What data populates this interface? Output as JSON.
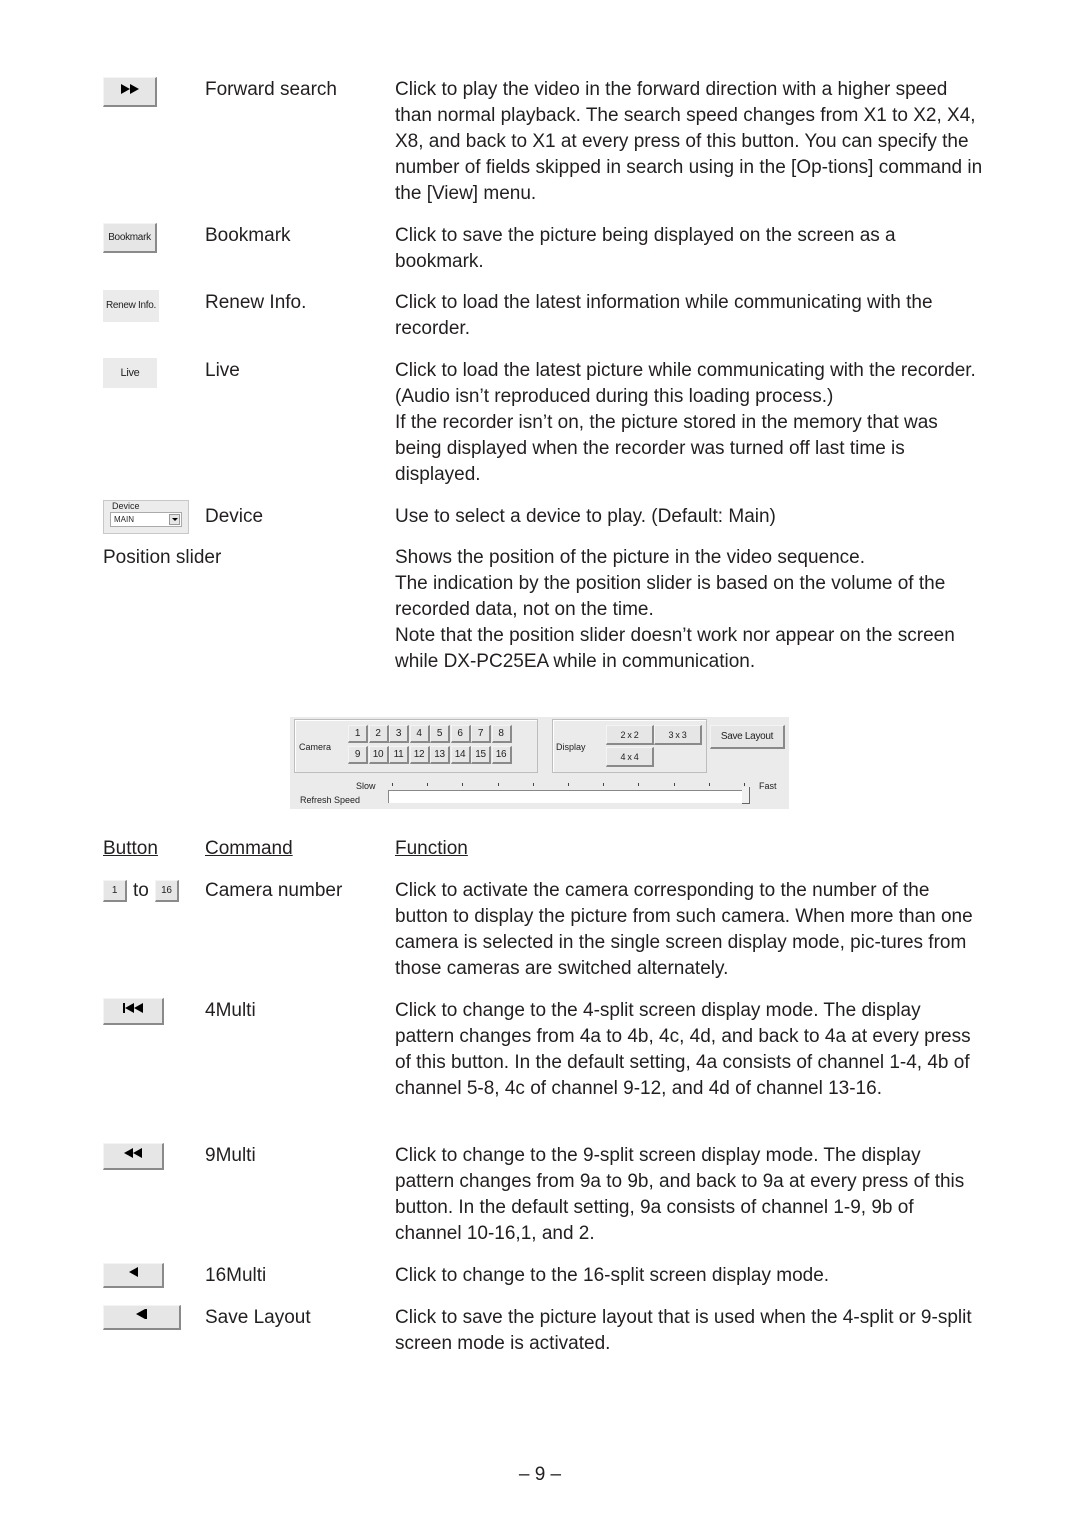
{
  "top_entries": [
    {
      "button_icon": "forward-search-icon",
      "command": "Forward search",
      "function": [
        "Click to play the video in the forward direction with a higher speed than normal playback. The search speed changes from X1 to X2, X4, X8, and back to X1 at every press of this button. You can specify the number of fields skipped in search using in the [Op-tions] command in the [View] menu."
      ]
    },
    {
      "button_label": "Bookmark",
      "command": "Bookmark",
      "function": [
        "Click to save the picture being displayed on the screen as a bookmark."
      ]
    },
    {
      "button_label": "Renew Info.",
      "command": "Renew Info.",
      "function": [
        "Click to load the latest information while communicating with the recorder."
      ]
    },
    {
      "button_label": "Live",
      "command": "Live",
      "function": [
        "Click to load the latest picture while communicating with the recorder. (Audio isn’t reproduced during this loading process.)",
        "If the recorder isn’t on, the picture stored in the memory that was being displayed when the recorder was turned off last time is displayed."
      ]
    },
    {
      "device_label": "Device",
      "device_value": "MAIN",
      "command": "Device",
      "function": [
        "Use to select a device to play.  (Default: Main)"
      ]
    }
  ],
  "position_slider": {
    "label": "Position slider",
    "function": [
      "Shows the position of the picture in the video sequence.",
      "The indication by the position slider is based on the volume of the recorded data, not on the time.",
      "Note that the position slider doesn’t work nor appear on the screen while DX-PC25EA while in communication."
    ]
  },
  "panel": {
    "camera_label": "Camera",
    "camera_buttons": [
      "1",
      "2",
      "3",
      "4",
      "5",
      "6",
      "7",
      "8",
      "9",
      "10",
      "11",
      "12",
      "13",
      "14",
      "15",
      "16"
    ],
    "display_label": "Display",
    "display_buttons": [
      "2 x 2",
      "3 x 3",
      "4 x 4"
    ],
    "save_layout": "Save Layout",
    "slow_label": "Slow",
    "fast_label": "Fast",
    "refresh_label": "Refresh Speed",
    "refresh_speed_fraction": 1.0
  },
  "table_header": {
    "button": "Button",
    "command": "Command",
    "function": "Function"
  },
  "bottom_entries": [
    {
      "button_from": "1",
      "button_to_word": "to",
      "button_to": "16",
      "command": "Camera number",
      "function": [
        "Click to activate the camera corresponding to the number of the button to display the picture from such camera. When more than one camera is selected in the single screen display mode, pic-tures from those cameras are switched alternately."
      ]
    },
    {
      "button_icon": "4multi-icon",
      "command": "4Multi",
      "function": [
        "Click to change to the 4-split screen display mode. The display pattern changes from 4a to 4b, 4c, 4d, and back to 4a at every press of this button. In the default setting, 4a consists of channel 1-4, 4b of channel 5-8, 4c of channel 9-12, and 4d of channel 13-16."
      ]
    },
    {
      "button_icon": "9multi-icon",
      "command": "9Multi",
      "function": [
        "Click to change to the 9-split screen display mode. The display pattern changes from 9a to 9b, and back to 9a at every press of this button. In the default setting, 9a consists of channel 1-9, 9b of channel 10-16,1, and 2."
      ]
    },
    {
      "button_icon": "16multi-icon",
      "command": "16Multi",
      "function": [
        "Click to change to the 16-split screen display mode."
      ]
    },
    {
      "button_icon": "save-layout-icon",
      "command": "Save Layout",
      "function": [
        "Click to save the picture layout that is used when the 4-split or 9-split screen mode is activated."
      ]
    }
  ],
  "page_number": "– 9 –"
}
